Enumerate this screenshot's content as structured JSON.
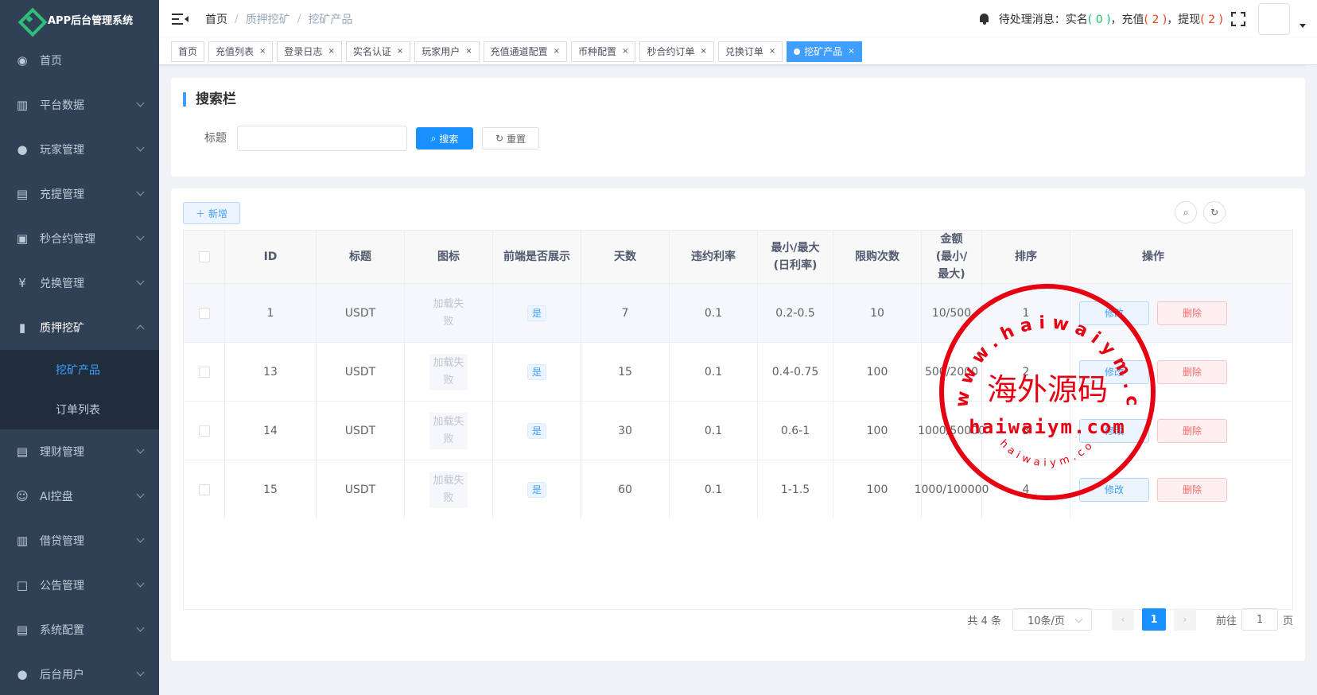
{
  "app": {
    "title": "APP后台管理系统"
  },
  "sidebar": {
    "items": [
      {
        "label": "首页",
        "icon": "dashboard-icon",
        "glyph": "◉"
      },
      {
        "label": "平台数据",
        "icon": "book-icon",
        "glyph": "▥"
      },
      {
        "label": "玩家管理",
        "icon": "user-icon",
        "glyph": "●"
      },
      {
        "label": "充提管理",
        "icon": "copy-icon",
        "glyph": "▤"
      },
      {
        "label": "秒合约管理",
        "icon": "monitor-icon",
        "glyph": "▣"
      },
      {
        "label": "兑换管理",
        "icon": "yen-icon",
        "glyph": "¥"
      },
      {
        "label": "质押挖矿",
        "icon": "bar-chart-icon",
        "glyph": "▮"
      }
    ],
    "submenu": [
      {
        "label": "挖矿产品"
      },
      {
        "label": "订单列表"
      }
    ],
    "items_after": [
      {
        "label": "理财管理",
        "icon": "document-icon",
        "glyph": "▤"
      },
      {
        "label": "AI控盘",
        "icon": "robot-icon",
        "glyph": "☺"
      },
      {
        "label": "借贷管理",
        "icon": "book-icon",
        "glyph": "▥"
      },
      {
        "label": "公告管理",
        "icon": "open-book-icon",
        "glyph": "□"
      },
      {
        "label": "系统配置",
        "icon": "document-icon",
        "glyph": "▤"
      },
      {
        "label": "后台用户",
        "icon": "users-icon",
        "glyph": "●"
      }
    ]
  },
  "navbar": {
    "breadcrumb": [
      "首页",
      "质押挖矿",
      "挖矿产品"
    ],
    "breadcrumb_sep": "/",
    "notice_prefix": "待处理消息：实名",
    "notice_realname": "( 0 )",
    "notice_recharge_label": "，充值",
    "notice_recharge": "( 2 )",
    "notice_withdraw_label": "，提现",
    "notice_withdraw": "( 2 )"
  },
  "tags": [
    {
      "label": "首页",
      "closable": false
    },
    {
      "label": "充值列表",
      "closable": true
    },
    {
      "label": "登录日志",
      "closable": true
    },
    {
      "label": "实名认证",
      "closable": true
    },
    {
      "label": "玩家用户",
      "closable": true
    },
    {
      "label": "充值通道配置",
      "closable": true
    },
    {
      "label": "币种配置",
      "closable": true
    },
    {
      "label": "秒合约订单",
      "closable": true
    },
    {
      "label": "兑换订单",
      "closable": true
    },
    {
      "label": "挖矿产品",
      "closable": true,
      "active": true
    }
  ],
  "tag_close": "×",
  "search": {
    "title": "搜索栏",
    "title_label": "标题",
    "title_value": "",
    "search_button": "搜索",
    "reset_button": "重置"
  },
  "toolbar": {
    "add_button": "新增"
  },
  "table": {
    "columns": [
      "ID",
      "标题",
      "图标",
      "前端是否展示",
      "天数",
      "违约利率",
      "最小/最大(日利率)",
      "限购次数",
      "金额(最小/最大)",
      "排序",
      "操作"
    ],
    "rows": [
      {
        "id": "1",
        "title": "USDT",
        "icon": "加载失败",
        "show": "是",
        "days": "7",
        "penalty": "0.1",
        "rate": "0.2-0.5",
        "limit": "10",
        "amount": "10/500",
        "sort": "1"
      },
      {
        "id": "13",
        "title": "USDT",
        "icon": "加载失败",
        "show": "是",
        "days": "15",
        "penalty": "0.1",
        "rate": "0.4-0.75",
        "limit": "100",
        "amount": "500/2000",
        "sort": "2"
      },
      {
        "id": "14",
        "title": "USDT",
        "icon": "加载失败",
        "show": "是",
        "days": "30",
        "penalty": "0.1",
        "rate": "0.6-1",
        "limit": "100",
        "amount": "1000/50000",
        "sort": "3"
      },
      {
        "id": "15",
        "title": "USDT",
        "icon": "加载失败",
        "show": "是",
        "days": "60",
        "penalty": "0.1",
        "rate": "1-1.5",
        "limit": "100",
        "amount": "1000/100000",
        "sort": "4"
      }
    ],
    "edit_label": "修改",
    "delete_label": "删除"
  },
  "pagination": {
    "total": "共 4 条",
    "page_size": "10条/页",
    "current": "1",
    "goto_prefix": "前往",
    "goto_value": "1",
    "goto_suffix": "页"
  },
  "watermark": {
    "top_arc": "www.haiwaiym.com",
    "center": "海外源码",
    "domain": "haiwaiym.com",
    "bottom_arc": "haiwaiym.com"
  },
  "colors": {
    "sidebar_bg": "#304156",
    "submenu_bg": "#1f2d3d",
    "primary": "#1890ff",
    "danger": "#f56c6c",
    "stamp": "#e60012"
  }
}
